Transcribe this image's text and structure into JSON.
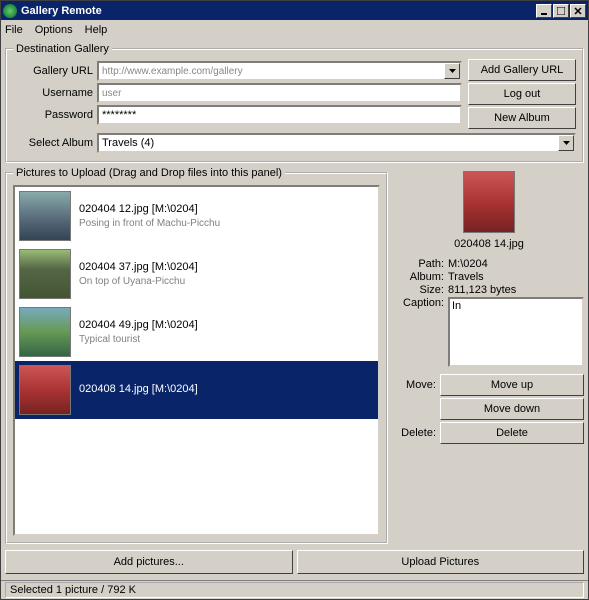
{
  "window": {
    "title": "Gallery Remote"
  },
  "menu": {
    "file": "File",
    "options": "Options",
    "help": "Help"
  },
  "dest": {
    "legend": "Destination Gallery",
    "gallery_url_label": "Gallery URL",
    "gallery_url_value": "http://www.example.com/gallery",
    "username_label": "Username",
    "username_value": "user",
    "password_label": "Password",
    "password_value": "********",
    "select_album_label": "Select Album",
    "select_album_value": "Travels (4)",
    "add_url_btn": "Add Gallery URL",
    "logout_btn": "Log out",
    "newalbum_btn": "New Album"
  },
  "list": {
    "legend": "Pictures to Upload (Drag and Drop files into this panel)",
    "items": [
      {
        "filename": "020404 12.jpg [M:\\0204]",
        "caption": "Posing in front of Machu-Picchu",
        "selected": false,
        "thumb": "t1"
      },
      {
        "filename": "020404 37.jpg [M:\\0204]",
        "caption": "On top of Uyana-Picchu",
        "selected": false,
        "thumb": "t2"
      },
      {
        "filename": "020404 49.jpg [M:\\0204]",
        "caption": "Typical tourist",
        "selected": false,
        "thumb": "t3"
      },
      {
        "filename": "020408 14.jpg [M:\\0204]",
        "caption": "",
        "selected": true,
        "thumb": "t4"
      }
    ]
  },
  "side": {
    "preview_filename": "020408 14.jpg",
    "path_label": "Path:",
    "path_value": "M:\\0204",
    "album_label": "Album:",
    "album_value": "Travels",
    "size_label": "Size:",
    "size_value": "811,123 bytes",
    "caption_label": "Caption:",
    "caption_value": "In ",
    "move_label": "Move:",
    "moveup_btn": "Move up",
    "movedown_btn": "Move down",
    "delete_label": "Delete:",
    "delete_btn": "Delete"
  },
  "bottom": {
    "add_btn": "Add pictures...",
    "upload_btn": "Upload Pictures"
  },
  "status": {
    "text": "Selected 1 picture / 792 K"
  }
}
